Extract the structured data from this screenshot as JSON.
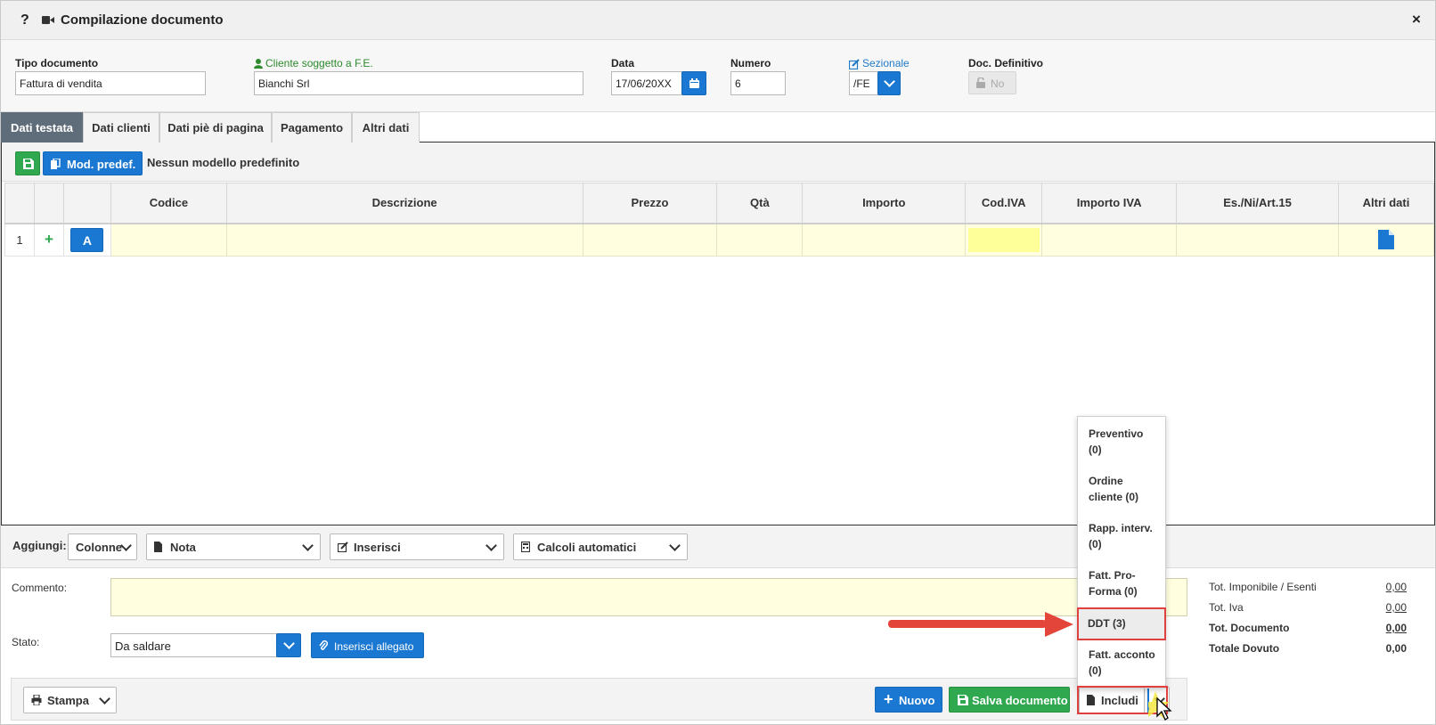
{
  "window": {
    "title": "Compilazione documento",
    "help_label": "?",
    "close_label": "×"
  },
  "header": {
    "tipo_documento": {
      "label": "Tipo documento",
      "value": "Fattura di vendita"
    },
    "cliente": {
      "label": "Cliente soggetto a F.E.",
      "value": "Bianchi Srl"
    },
    "data": {
      "label": "Data",
      "value": "17/06/20XX"
    },
    "numero": {
      "label": "Numero",
      "value": "6"
    },
    "sezionale": {
      "label": "Sezionale",
      "value": "/FE"
    },
    "doc_definitivo": {
      "label": "Doc. Definitivo",
      "value": "No"
    }
  },
  "tabs": [
    {
      "label": "Dati testata",
      "active": true
    },
    {
      "label": "Dati clienti",
      "active": false
    },
    {
      "label": "Dati piè di pagina",
      "active": false
    },
    {
      "label": "Pagamento",
      "active": false
    },
    {
      "label": "Altri dati",
      "active": false
    }
  ],
  "grid_toolbar": {
    "model_button": "Mod. predef.",
    "model_text": "Nessun modello predefinito"
  },
  "grid": {
    "columns": [
      "",
      "",
      "",
      "Codice",
      "Descrizione",
      "Prezzo",
      "Qtà",
      "Importo",
      "Cod.IVA",
      "Importo IVA",
      "Es./Ni/Art.15",
      "Altri dati"
    ],
    "rows": [
      {
        "num": "1",
        "plus": "+",
        "type": "A"
      }
    ]
  },
  "aggiungi": {
    "label": "Aggiungi:",
    "colonne": "Colonne",
    "nota": "Nota",
    "inserisci": "Inserisci",
    "calcoli": "Calcoli automatici"
  },
  "comment": {
    "label": "Commento:"
  },
  "stato": {
    "label": "Stato:",
    "value": "Da saldare",
    "attach_button": "Inserisci allegato"
  },
  "totals": [
    {
      "label": "Tot. Imponibile / Esenti",
      "value": "0,00",
      "bold": false
    },
    {
      "label": "Tot. Iva",
      "value": "0,00",
      "bold": false
    },
    {
      "label": "Tot. Documento",
      "value": "0,00",
      "bold": true
    },
    {
      "label": "Totale Dovuto",
      "value": "0,00",
      "bold": true
    }
  ],
  "actions": {
    "stampa": "Stampa",
    "nuovo": "Nuovo",
    "salva": "Salva documento",
    "includi": "Includi"
  },
  "include_menu": [
    {
      "line1": "Preventivo",
      "line2": "(0)"
    },
    {
      "line1": "Ordine",
      "line2": "cliente (0)"
    },
    {
      "line1": "Rapp. interv.",
      "line2": "(0)"
    },
    {
      "line1": "Fatt. Pro-",
      "line2": "Forma (0)"
    },
    {
      "line1": "DDT (3)",
      "line2": ""
    },
    {
      "line1": "Fatt. acconto",
      "line2": "(0)"
    }
  ],
  "colors": {
    "accent": "#1a78d2",
    "success": "#2fa84f",
    "highlight": "#e04040",
    "row_bg": "#ffffdf",
    "tab_active": "#5f6d7a"
  }
}
